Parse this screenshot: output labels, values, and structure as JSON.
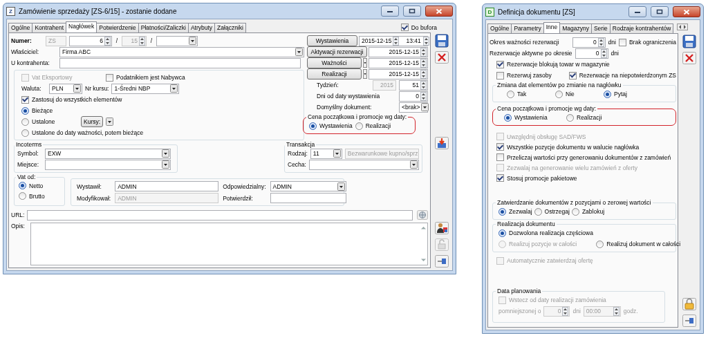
{
  "order_window": {
    "app_letter": "Z",
    "title": "Zamówienie sprzedaży [ZS-6/15] - zostanie dodane",
    "tabs": [
      {
        "label": "Ogólne",
        "selected": false
      },
      {
        "label": "Kontrahent",
        "selected": false
      },
      {
        "label": "Nagłówek",
        "selected": true
      },
      {
        "label": "Potwierdzenie",
        "selected": false
      },
      {
        "label": "Płatności/Zaliczki",
        "selected": false
      },
      {
        "label": "Atrybuty",
        "selected": false
      },
      {
        "label": "Załączniki",
        "selected": false
      }
    ],
    "buffer": {
      "label": "Do bufora",
      "checked": true
    },
    "number": {
      "label": "Numer:",
      "series": "ZS",
      "number": "6",
      "year": "15",
      "separators": [
        "/",
        "/"
      ]
    },
    "owner": {
      "label": "Właściciel:",
      "value": "Firma ABC"
    },
    "contractor_ref": {
      "label": "U kontrahenta:"
    },
    "currency_group": {
      "checkboxes": [
        {
          "label": "Vat Eksportowy",
          "checked": false,
          "disabled": true
        },
        {
          "label": "Podatnikiem jest Nabywca",
          "checked": false,
          "disabled": false
        }
      ],
      "currency_label": "Waluta:",
      "currency": "PLN",
      "rate_label": "Nr kursu:",
      "rate": "1-Średni NBP",
      "apply_all": {
        "label": "Zastosuj do wszystkich elementów",
        "checked": true
      },
      "rate_modes": [
        {
          "label": "Bieżące",
          "selected": true
        },
        {
          "label": "Ustalone",
          "selected": false
        },
        {
          "label": "Ustalone do daty ważności, potem bieżące",
          "selected": false
        }
      ],
      "rates_button": "Kursy:"
    },
    "incoterms": {
      "title": "Incoterms",
      "symbol_label": "Symbol:",
      "symbol": "EXW",
      "place_label": "Miejsce:"
    },
    "transaction": {
      "title": "Transakcja",
      "type_label": "Rodzaj:",
      "type": "11",
      "type_name": "Bezwarunkowe kupno/sprz",
      "feature_label": "Cecha:"
    },
    "vat_from": {
      "title": "Vat od:",
      "options": [
        {
          "label": "Netto",
          "selected": true
        },
        {
          "label": "Brutto",
          "selected": false
        }
      ]
    },
    "users": {
      "issued_label": "Wystawił:",
      "issued": "ADMIN",
      "modified_label": "Modyfikował:",
      "modified": "ADMIN",
      "responsible_label": "Odpowiedzialny:",
      "responsible": "ADMIN",
      "confirmed_label": "Potwierdził:"
    },
    "url_label": "URL:",
    "description_label": "Opis:",
    "dates": [
      {
        "label": "Wystawienia",
        "date": "2015-12-15",
        "time": "13:41",
        "menu": false
      },
      {
        "label": "Aktywacji rezerwacji",
        "date": "2015-12-15",
        "menu": false
      },
      {
        "label": "Ważności",
        "date": "2015-12-15",
        "menu": true
      },
      {
        "label": "Realizacji",
        "date": "2015-12-15",
        "menu": true
      }
    ],
    "week": {
      "label": "Tydzień:",
      "year": "2015",
      "week": "51"
    },
    "days": {
      "label": "Dni od daty wystawienia",
      "value": "0"
    },
    "default_doc": {
      "label": "Domyślny dokument:",
      "value": "<brak>"
    },
    "price_date": {
      "title": "Cena początkowa i promocje wg daty:",
      "highlighted": true,
      "options": [
        {
          "label": "Wystawienia",
          "selected": true
        },
        {
          "label": "Realizacji",
          "selected": false
        }
      ]
    }
  },
  "definition_window": {
    "app_letter": "D",
    "title": "Definicja dokumentu [ZS]",
    "tabs": [
      {
        "label": "Ogólne",
        "selected": false
      },
      {
        "label": "Parametry",
        "selected": false
      },
      {
        "label": "Inne",
        "selected": true
      },
      {
        "label": "Magazyny",
        "selected": false
      },
      {
        "label": "Serie",
        "selected": false
      },
      {
        "label": "Rodzaje kontrahentów",
        "selected": false
      }
    ],
    "reservation_period": {
      "label": "Okres ważności rezerwacji",
      "value": "0",
      "unit": "dni",
      "no_limit": {
        "label": "Brak ograniczenia",
        "checked": false
      }
    },
    "active_after": {
      "label": "Rezerwacje aktywne po okresie",
      "value": "0",
      "unit": "dni"
    },
    "reservation_options": [
      {
        "label": "Rezerwacje blokują towar w magazynie",
        "checked": true
      },
      {
        "label": "Rezerwuj zasoby",
        "checked": false
      },
      {
        "label": "Rezerwacje na niepotwierdzonym ZS",
        "checked": true
      }
    ],
    "date_change": {
      "title": "Zmiana dat elementów po zmianie na nagłówku",
      "options": [
        {
          "label": "Tak",
          "selected": false
        },
        {
          "label": "Nie",
          "selected": false
        },
        {
          "label": "Pytaj",
          "selected": true
        }
      ]
    },
    "price_date": {
      "title": "Cena początkowa i promocje wg daty:",
      "highlighted": true,
      "options": [
        {
          "label": "Wystawienia",
          "selected": true
        },
        {
          "label": "Realizacji",
          "selected": false
        }
      ]
    },
    "options": [
      {
        "label": "Uwzględnij obsługę SAD/FWS",
        "checked": false,
        "disabled": true
      },
      {
        "label": "Wszystkie pozycje dokumentu w walucie nagłówka",
        "checked": true,
        "disabled": false
      },
      {
        "label": "Przeliczaj wartości przy generowaniu dokumentów z zamówień",
        "checked": false,
        "disabled": false
      },
      {
        "label": "Zezwalaj na generowanie wielu zamówień z oferty",
        "checked": false,
        "disabled": true
      },
      {
        "label": "Stosuj promocje pakietowe",
        "checked": true,
        "disabled": false
      }
    ],
    "zero_value": {
      "title": "Zatwierdzanie dokumentów z pozycjami o zerowej wartości",
      "options": [
        {
          "label": "Zezwalaj",
          "selected": true
        },
        {
          "label": "Ostrzegaj",
          "selected": false
        },
        {
          "label": "Zablokuj",
          "selected": false
        }
      ]
    },
    "realization": {
      "title": "Realizacja dokumentu",
      "options": [
        {
          "label": "Dozwolona realizacja częściowa",
          "selected": true,
          "disabled": false
        },
        {
          "label": "Realizuj pozycje w całości",
          "selected": false,
          "disabled": true
        },
        {
          "label": "Realizuj dokument w całości",
          "selected": false,
          "disabled": false
        }
      ]
    },
    "auto_confirm": {
      "label": "Automatycznie zatwierdzaj ofertę",
      "checked": false,
      "disabled": true
    },
    "planning": {
      "title": "Data planowania",
      "backward": {
        "label": "Wstecz od daty realizacji zamówienia",
        "checked": false,
        "disabled": true
      },
      "reduced_label": "pomniejszonej o",
      "days": "0",
      "days_unit": "dni",
      "time": "00:00",
      "time_unit": "godz."
    }
  }
}
